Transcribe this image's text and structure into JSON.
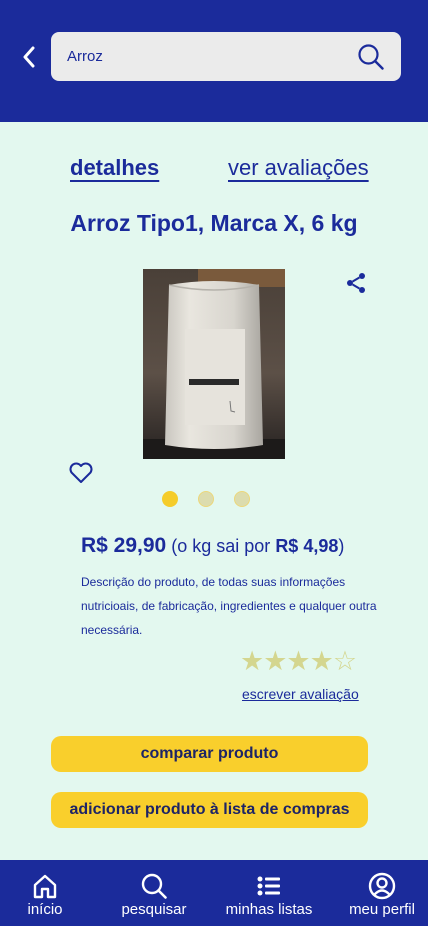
{
  "search": {
    "value": "Arroz",
    "icon": "search-icon"
  },
  "tabs": {
    "details": "detalhes",
    "reviews": "ver avaliações"
  },
  "product": {
    "title": "Arroz Tipo1, Marca X, 6 kg",
    "image_count": 3,
    "active_image_index": 0,
    "price": "R$ 29,90",
    "price_per_kg_prefix": "(o kg sai por",
    "price_per_kg": "R$ 4,98",
    "price_per_kg_suffix": ")",
    "description": "Descrição do produto, de todas suas informações nutricioais, de fabricação, ingredientes e qualquer outra necessária.",
    "rating": 4,
    "rating_max": 5,
    "stars_text": "★★★★☆"
  },
  "actions": {
    "write_review": "escrever avaliação",
    "compare": "comparar produto",
    "add_to_list": "adicionar produto à lista de compras"
  },
  "nav": [
    {
      "label": "início",
      "icon": "home-icon"
    },
    {
      "label": "pesquisar",
      "icon": "search-icon"
    },
    {
      "label": "minhas listas",
      "icon": "list-icon"
    },
    {
      "label": "meu perfil",
      "icon": "profile-icon"
    }
  ],
  "colors": {
    "primary": "#1b2b9b",
    "accent": "#f9cf2c",
    "background": "#e3f8ef"
  }
}
